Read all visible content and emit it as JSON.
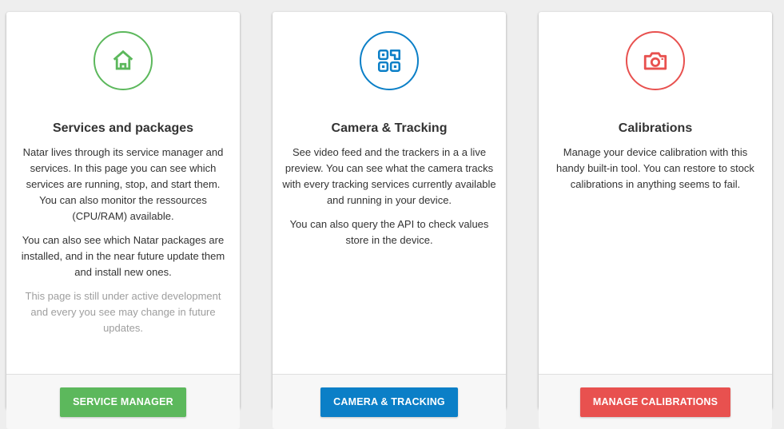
{
  "colors": {
    "green": "#5cb85c",
    "blue": "#0b7fc7",
    "red": "#e8514f"
  },
  "cards": [
    {
      "icon": "home-icon",
      "title": "Services and packages",
      "paragraphs": [
        "Natar lives through its service manager and services. In this page you can see which services are running, stop, and start them. You can also monitor the ressources (CPU/RAM) available.",
        "You can also see which Natar packages are installed, and in the near future update them and install new ones."
      ],
      "note": "This page is still under active development and every you see may change in future updates.",
      "button_label": "SERVICE MANAGER"
    },
    {
      "icon": "qr-code-icon",
      "title": "Camera & Tracking",
      "paragraphs": [
        "See video feed and the trackers in a a live preview. You can see what the camera tracks with every tracking services currently available and running in your device.",
        "You can also query the API to check values store in the device."
      ],
      "button_label": "CAMERA & TRACKING"
    },
    {
      "icon": "camera-icon",
      "title": "Calibrations",
      "paragraphs": [
        "Manage your device calibration with this handy built-in tool. You can restore to stock calibrations in anything seems to fail."
      ],
      "button_label": "MANAGE CALIBRATIONS"
    }
  ]
}
